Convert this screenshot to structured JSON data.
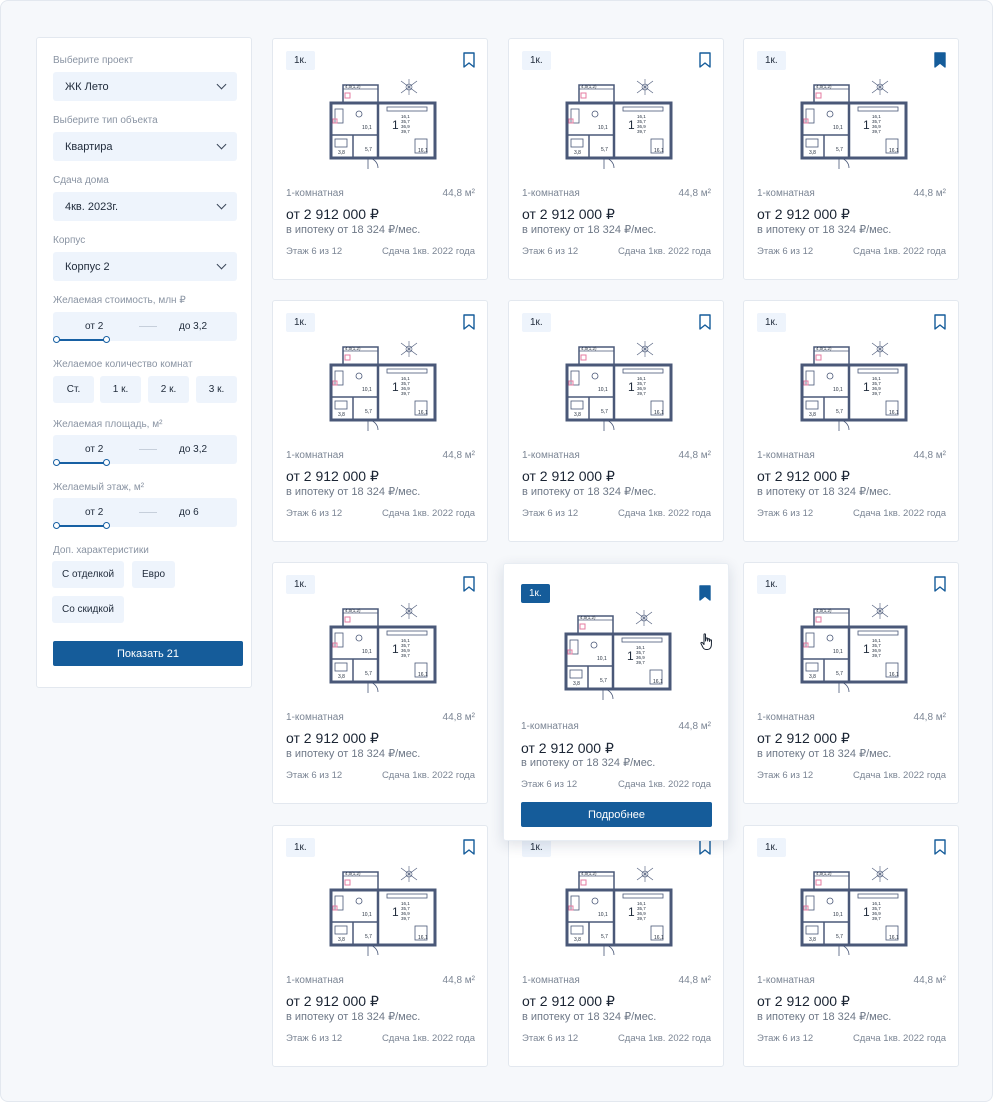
{
  "filters": {
    "project": {
      "label": "Выберите проект",
      "value": "ЖК Лето"
    },
    "object_type": {
      "label": "Выберите тип объекта",
      "value": "Квартира"
    },
    "completion": {
      "label": "Сдача дома",
      "value": "4кв. 2023г."
    },
    "building": {
      "label": "Корпус",
      "value": "Корпус 2"
    },
    "price": {
      "label": "Желаемая стоимость, млн ₽",
      "from": "от 2",
      "to": "до 3,2"
    },
    "rooms": {
      "label": "Желаемое количество комнат",
      "options": [
        "Ст.",
        "1 к.",
        "2 к.",
        "3 к."
      ]
    },
    "area": {
      "label": "Желаемая площадь, м²",
      "from": "от 2",
      "to": "до 3,2"
    },
    "floor": {
      "label": "Желаемый этаж, м²",
      "from": "от 2",
      "to": "до 6"
    },
    "extra": {
      "label": "Доп. характеристики",
      "options": [
        "С отделкой",
        "Евро",
        "Со скидкой"
      ]
    },
    "show_button": "Показать 21"
  },
  "cards": [
    {
      "badge": "1к.",
      "type": "1-комнатная",
      "area": "44,8 м²",
      "price": "от 2 912 000 ₽",
      "mortgage": "в ипотеку от 18 324 ₽/мес.",
      "floor": "Этаж 6 из 12",
      "due": "Сдача 1кв. 2022 года",
      "saved": false
    },
    {
      "badge": "1к.",
      "type": "1-комнатная",
      "area": "44,8 м²",
      "price": "от 2 912 000 ₽",
      "mortgage": "в ипотеку от 18 324 ₽/мес.",
      "floor": "Этаж 6 из 12",
      "due": "Сдача 1кв. 2022 года",
      "saved": false
    },
    {
      "badge": "1к.",
      "type": "1-комнатная",
      "area": "44,8 м²",
      "price": "от 2 912 000 ₽",
      "mortgage": "в ипотеку от 18 324 ₽/мес.",
      "floor": "Этаж 6 из 12",
      "due": "Сдача 1кв. 2022 года",
      "saved": true
    },
    {
      "badge": "1к.",
      "type": "1-комнатная",
      "area": "44,8 м²",
      "price": "от 2 912 000 ₽",
      "mortgage": "в ипотеку от 18 324 ₽/мес.",
      "floor": "Этаж 6 из 12",
      "due": "Сдача 1кв. 2022 года",
      "saved": false
    },
    {
      "badge": "1к.",
      "type": "1-комнатная",
      "area": "44,8 м²",
      "price": "от 2 912 000 ₽",
      "mortgage": "в ипотеку от 18 324 ₽/мес.",
      "floor": "Этаж 6 из 12",
      "due": "Сдача 1кв. 2022 года",
      "saved": false
    },
    {
      "badge": "1к.",
      "type": "1-комнатная",
      "area": "44,8 м²",
      "price": "от 2 912 000 ₽",
      "mortgage": "в ипотеку от 18 324 ₽/мес.",
      "floor": "Этаж 6 из 12",
      "due": "Сдача 1кв. 2022 года",
      "saved": false
    },
    {
      "badge": "1к.",
      "type": "1-комнатная",
      "area": "44,8 м²",
      "price": "от 2 912 000 ₽",
      "mortgage": "в ипотеку от 18 324 ₽/мес.",
      "floor": "Этаж 6 из 12",
      "due": "Сдача 1кв. 2022 года",
      "saved": false
    },
    {
      "badge": "1к.",
      "type": "1-комнатная",
      "area": "44,8 м²",
      "price": "от 2 912 000 ₽",
      "mortgage": "в ипотеку от 18 324 ₽/мес.",
      "floor": "Этаж 6 из 12",
      "due": "Сдача 1кв. 2022 года",
      "saved": true,
      "details_button": "Подробнее"
    },
    {
      "badge": "1к.",
      "type": "1-комнатная",
      "area": "44,8 м²",
      "price": "от 2 912 000 ₽",
      "mortgage": "в ипотеку от 18 324 ₽/мес.",
      "floor": "Этаж 6 из 12",
      "due": "Сдача 1кв. 2022 года",
      "saved": false
    },
    {
      "badge": "1к.",
      "type": "1-комнатная",
      "area": "44,8 м²",
      "price": "от 2 912 000 ₽",
      "mortgage": "в ипотеку от 18 324 ₽/мес.",
      "floor": "Этаж 6 из 12",
      "due": "Сдача 1кв. 2022 года",
      "saved": false
    },
    {
      "badge": "1к.",
      "type": "1-комнатная",
      "area": "44,8 м²",
      "price": "от 2 912 000 ₽",
      "mortgage": "в ипотеку от 18 324 ₽/мес.",
      "floor": "Этаж 6 из 12",
      "due": "Сдача 1кв. 2022 года",
      "saved": false
    },
    {
      "badge": "1к.",
      "type": "1-комнатная",
      "area": "44,8 м²",
      "price": "от 2 912 000 ₽",
      "mortgage": "в ипотеку от 18 324 ₽/мес.",
      "floor": "Этаж 6 из 12",
      "due": "Сдача 1кв. 2022 года",
      "saved": false
    }
  ],
  "plan_labels": {
    "balcony": "4,0(1,2)",
    "living": "10,1",
    "corridor": "5,7",
    "bath": "3,8",
    "kitchen": "16,1",
    "room_no": "1",
    "room_areas": [
      "16,1",
      "35,7",
      "36,9",
      "39,7"
    ]
  },
  "colors": {
    "accent": "#155c9a",
    "plan_wall": "#4a5878",
    "field_bg": "#eef4fc"
  }
}
